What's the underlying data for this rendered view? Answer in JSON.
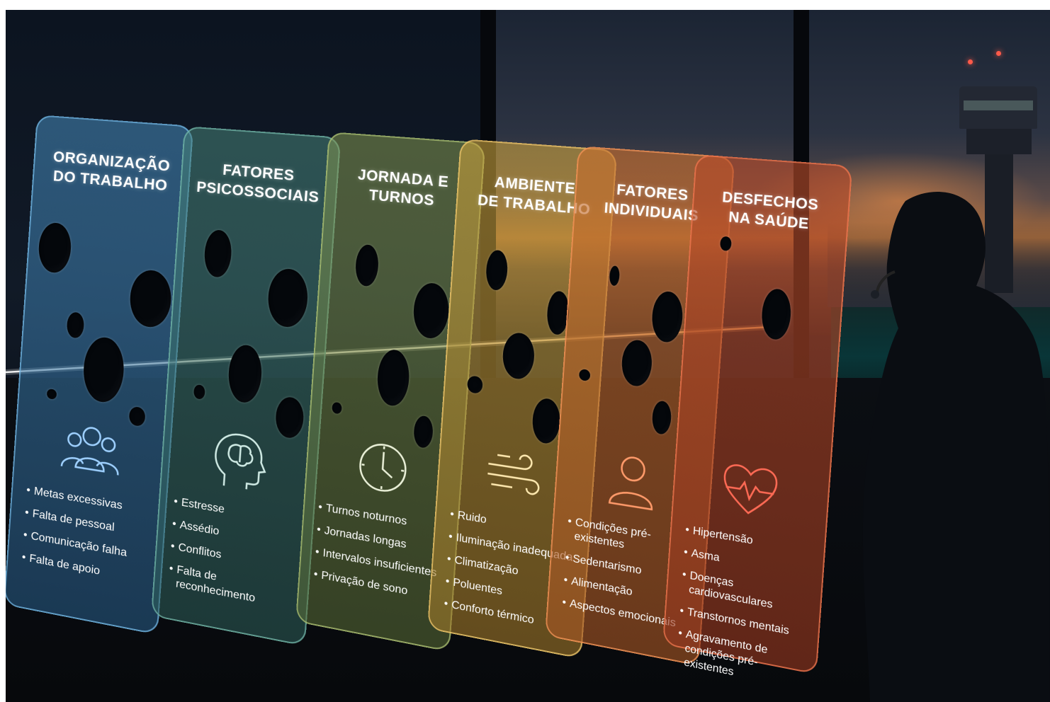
{
  "colors": {
    "panel_blue": "#4f8cbe",
    "panel_teal": "#4a8b80",
    "panel_olive": "#8a9a52",
    "panel_gold": "#c9a03c",
    "panel_orange": "#c86e2d",
    "panel_red": "#b94b28",
    "icon_red": "#ff6a55",
    "beam": "#ffffff"
  },
  "panels": [
    {
      "title_line1": "ORGANIZAÇÃO",
      "title_line2": "DO TRABALHO",
      "icon": "team-people-icon",
      "items": [
        "Metas excessivas",
        "Falta de pessoal",
        "Comunicação falha",
        "Falta de apoio"
      ]
    },
    {
      "title_line1": "FATORES",
      "title_line2": "PSICOSSOCIAIS",
      "icon": "brain-head-icon",
      "items": [
        "Estresse",
        "Assédio",
        "Conflitos",
        "Falta de reconhecimento"
      ]
    },
    {
      "title_line1": "JORNADA E",
      "title_line2": "TURNOS",
      "icon": "clock-icon",
      "items": [
        "Turnos noturnos",
        "Jornadas longas",
        "Intervalos insuficientes",
        "Privação de sono"
      ]
    },
    {
      "title_line1": "AMBIENTE",
      "title_line2": "DE TRABALHO",
      "icon": "wind-icon",
      "items": [
        "Ruido",
        "Iluminação inadequada",
        "Climatização",
        "Poluentes",
        "Conforto térmico"
      ]
    },
    {
      "title_line1": "FATORES",
      "title_line2": "INDIVIDUAIS",
      "icon": "person-icon",
      "items": [
        "Condições pré-existentes",
        "Sedentarismo",
        "Alimentação",
        "Aspectos emocionais"
      ]
    },
    {
      "title_line1": "DESFECHOS",
      "title_line2": "NA SAÚDE",
      "icon": "heart-pulse-icon",
      "items": [
        "Hipertensão",
        "Asma",
        "Doenças cardiovasculares",
        "Transtornos mentais",
        "Agravamento de condições pré-existentes"
      ]
    }
  ]
}
